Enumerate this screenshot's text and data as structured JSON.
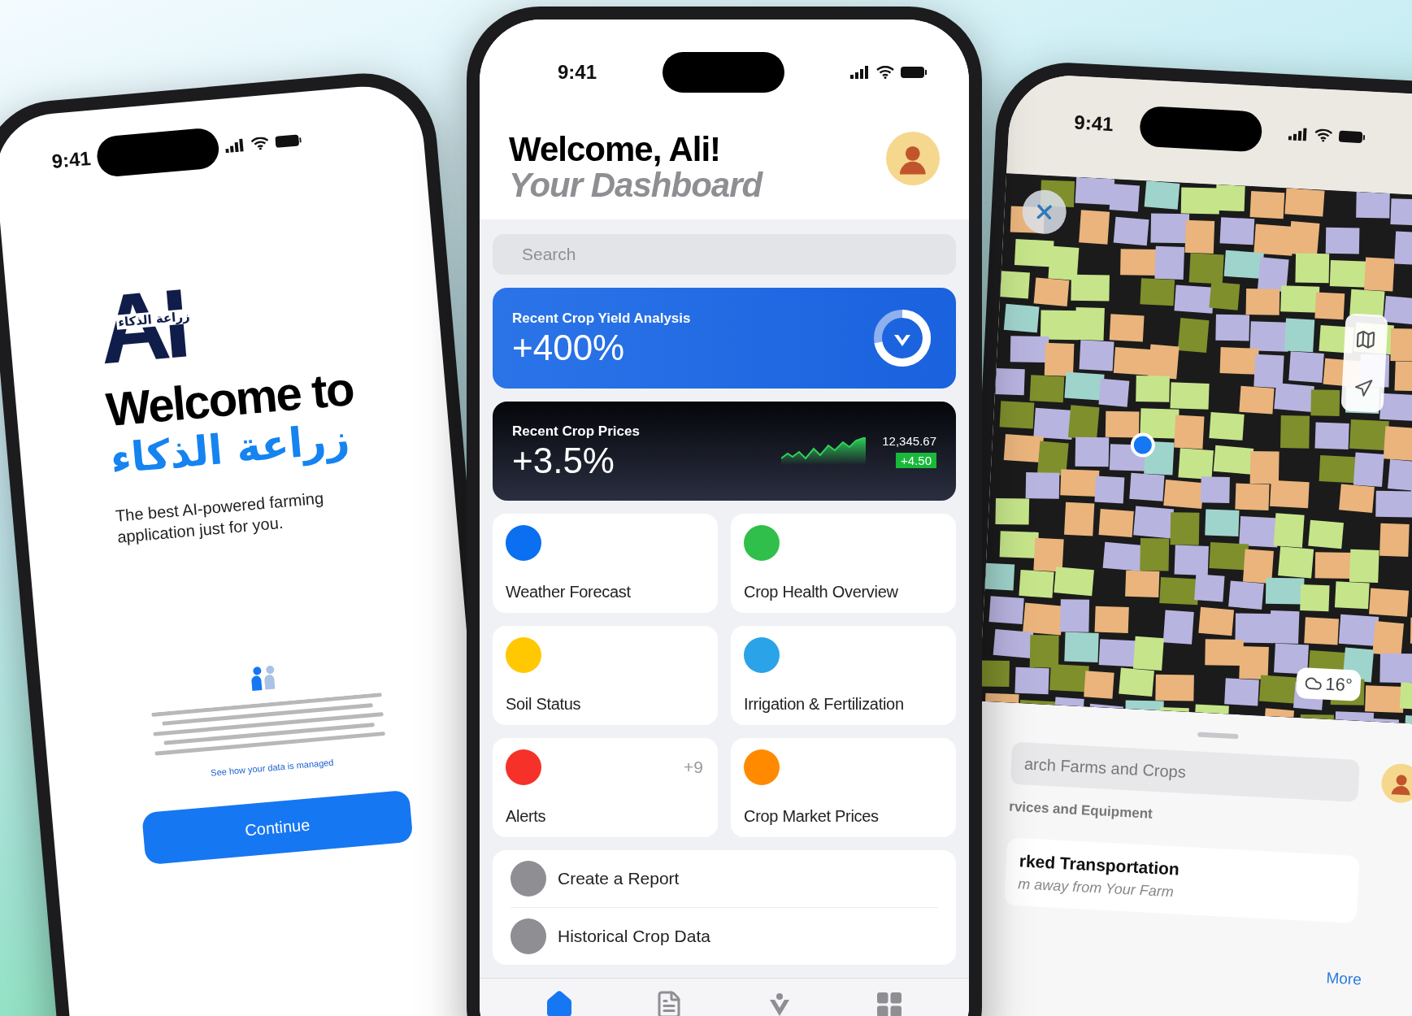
{
  "onboarding_phone": {
    "time": "9:41",
    "logo": {
      "letters": "AI",
      "arabic": "زراعة الذكاء"
    },
    "title": "Welcome to",
    "title_arabic": "زراعة الذكاء",
    "subtitle": "The best AI-powered farming application just for you.",
    "privacy_link": "See how your data is managed",
    "button": "Continue"
  },
  "dashboard_phone": {
    "time": "9:41",
    "greeting": "Welcome, Ali!",
    "heading": "Your Dashboard",
    "search": {
      "placeholder": "Search"
    },
    "yield_card": {
      "title": "Recent Crop Yield Analysis",
      "value": "+400%",
      "level": 0.72
    },
    "price_card": {
      "title": "Recent Crop Prices",
      "value": "+3.5%",
      "index": "12,345.67",
      "change": "+4.50"
    },
    "tiles": [
      {
        "label": "Weather Forecast",
        "color": "#0a6ff0"
      },
      {
        "label": "Crop Health Overview",
        "color": "#2fbf4a"
      },
      {
        "label": "Soil Status",
        "color": "#ffc800"
      },
      {
        "label": "Irrigation & Fertilization",
        "color": "#2aa3e8"
      },
      {
        "label": "Alerts",
        "color": "#f5312a",
        "badge": "+9"
      },
      {
        "label": "Crop Market Prices",
        "color": "#ff8a00"
      }
    ],
    "list": [
      "Create a Report",
      "Historical Crop Data"
    ],
    "tab_bar": [
      {
        "kind": "home",
        "selected": true
      },
      {
        "kind": "document",
        "selected": false
      },
      {
        "kind": "logo",
        "selected": false
      },
      {
        "kind": "grid",
        "selected": false
      }
    ]
  },
  "map_phone": {
    "time": "9:41",
    "weather": "16°",
    "search": {
      "placeholder": "arch Farms and Crops"
    },
    "section": "rvices and Equipment",
    "result": {
      "title": "rked Transportation",
      "subtitle": "m away from Your Farm"
    },
    "more_link": "More"
  }
}
